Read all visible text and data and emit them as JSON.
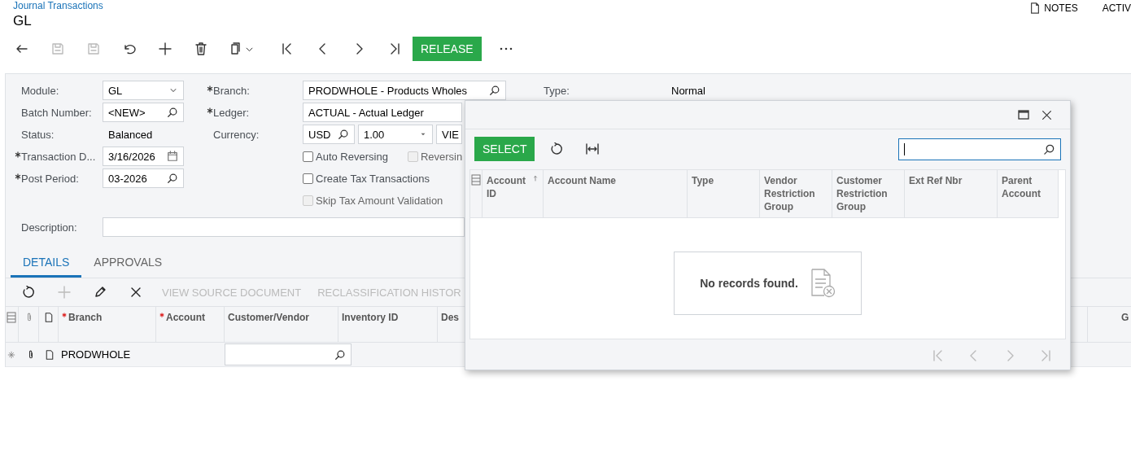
{
  "breadcrumb": "Journal Transactions",
  "title": "GL",
  "header_links": [
    {
      "label": "NOTES",
      "kind": "notes"
    },
    {
      "label": "ACTIV",
      "kind": "plain"
    }
  ],
  "toolbar": [
    {
      "kind": "back",
      "disabled": false
    },
    {
      "kind": "save-close",
      "disabled": true
    },
    {
      "kind": "save",
      "disabled": true
    },
    {
      "kind": "undo",
      "disabled": false
    },
    {
      "kind": "add",
      "disabled": false
    },
    {
      "kind": "delete",
      "disabled": false
    },
    {
      "kind": "copy",
      "disabled": false
    },
    {
      "kind": "first",
      "disabled": false
    },
    {
      "kind": "prev",
      "disabled": false
    },
    {
      "kind": "next",
      "disabled": false
    },
    {
      "kind": "last",
      "disabled": false
    },
    {
      "kind": "action",
      "label": "RELEASE",
      "disabled": false
    },
    {
      "kind": "more",
      "disabled": false
    }
  ],
  "left_fields": [
    {
      "label": "Module:",
      "required": false,
      "kind": "select",
      "value": "GL"
    },
    {
      "label": "Batch Number:",
      "required": false,
      "kind": "lookup",
      "value": "<NEW>"
    },
    {
      "label": "Status:",
      "required": false,
      "kind": "text",
      "value": "Balanced"
    },
    {
      "label": "Transaction D...",
      "required": true,
      "kind": "date",
      "value": "3/16/2026"
    },
    {
      "label": "Post Period:",
      "required": true,
      "kind": "lookup",
      "value": "03-2026"
    }
  ],
  "branch": {
    "label": "Branch:",
    "required": true,
    "value": "PRODWHOLE - Products Wholes"
  },
  "ledger": {
    "label": "Ledger:",
    "required": true,
    "value": "ACTUAL - Actual Ledger"
  },
  "currency": {
    "label": "Currency:",
    "code": "USD",
    "rate": "1.00",
    "view_button": "VIE"
  },
  "checkbox_rows": [
    [
      {
        "label": "Auto Reversing",
        "checked": false,
        "disabled": false
      },
      {
        "label": "Reversin",
        "checked": false,
        "disabled": true
      }
    ],
    [
      {
        "label": "Create Tax Transactions",
        "checked": false,
        "disabled": false
      }
    ],
    [
      {
        "label": "Skip Tax Amount Validation",
        "checked": false,
        "disabled": true
      }
    ]
  ],
  "type": {
    "label": "Type:",
    "value": "Normal"
  },
  "description": {
    "label": "Description:"
  },
  "tabs": [
    {
      "label": "DETAILS",
      "selected": true
    },
    {
      "label": "APPROVALS",
      "selected": false
    }
  ],
  "details_toolbar": [
    {
      "kind": "refresh",
      "disabled": false
    },
    {
      "kind": "add",
      "disabled": true
    },
    {
      "kind": "edit",
      "disabled": false
    },
    {
      "kind": "remove",
      "disabled": false
    },
    {
      "kind": "text",
      "label": "VIEW SOURCE DOCUMENT",
      "disabled": true
    },
    {
      "kind": "text",
      "label": "RECLASSIFICATION HISTOR",
      "disabled": true
    }
  ],
  "details_columns": [
    {
      "kind": "selector"
    },
    {
      "kind": "attach"
    },
    {
      "kind": "note"
    },
    {
      "kind": "text",
      "label": "Branch",
      "required": true
    },
    {
      "kind": "text",
      "label": "Account",
      "required": true
    },
    {
      "kind": "text",
      "label": "Customer/Vendor",
      "required": false
    },
    {
      "kind": "text",
      "label": "Inventory ID",
      "required": false
    },
    {
      "kind": "text",
      "label": "Des",
      "required": false
    },
    {
      "kind": "text",
      "label": "G",
      "required": false
    }
  ],
  "details_rows": [
    {
      "new": true,
      "branch": "PRODWHOLE"
    }
  ],
  "popup": {
    "select_button": "SELECT",
    "search_focused": true,
    "columns": [
      {
        "label": "Account ID",
        "sorted": true
      },
      {
        "label": "Account Name",
        "sorted": false
      },
      {
        "label": "Type",
        "sorted": false
      },
      {
        "label": "Vendor Restriction Group",
        "sorted": false
      },
      {
        "label": "Customer Restriction Group",
        "sorted": false
      },
      {
        "label": "Ext Ref Nbr",
        "sorted": false
      },
      {
        "label": "Parent Account",
        "sorted": false
      }
    ],
    "empty_message": "No records found."
  }
}
